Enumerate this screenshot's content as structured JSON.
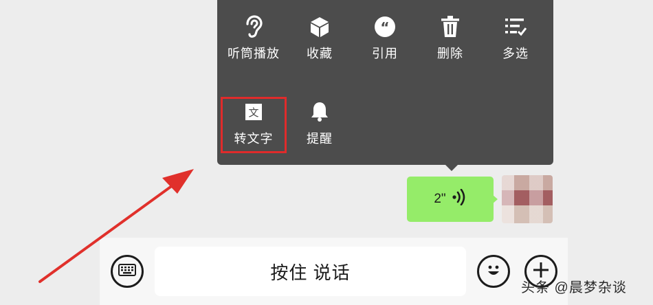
{
  "context_menu": {
    "row1": [
      {
        "label": "听筒播放",
        "icon": "ear-icon"
      },
      {
        "label": "收藏",
        "icon": "cube-icon"
      },
      {
        "label": "引用",
        "icon": "quote-icon"
      },
      {
        "label": "删除",
        "icon": "trash-icon"
      },
      {
        "label": "多选",
        "icon": "multi-select-icon"
      }
    ],
    "row2": [
      {
        "label": "转文字",
        "icon": "text-convert-icon",
        "icon_text": "文",
        "highlighted": true
      },
      {
        "label": "提醒",
        "icon": "bell-icon"
      }
    ]
  },
  "voice_message": {
    "duration": "2\""
  },
  "input_bar": {
    "hold_to_talk": "按住 说话"
  },
  "watermark": "头条 @晨梦杂谈",
  "colors": {
    "menu_bg": "#4c4c4c",
    "bubble_green": "#95ec69",
    "highlight_red": "#e02b2b",
    "arrow_red": "#e0302b"
  }
}
